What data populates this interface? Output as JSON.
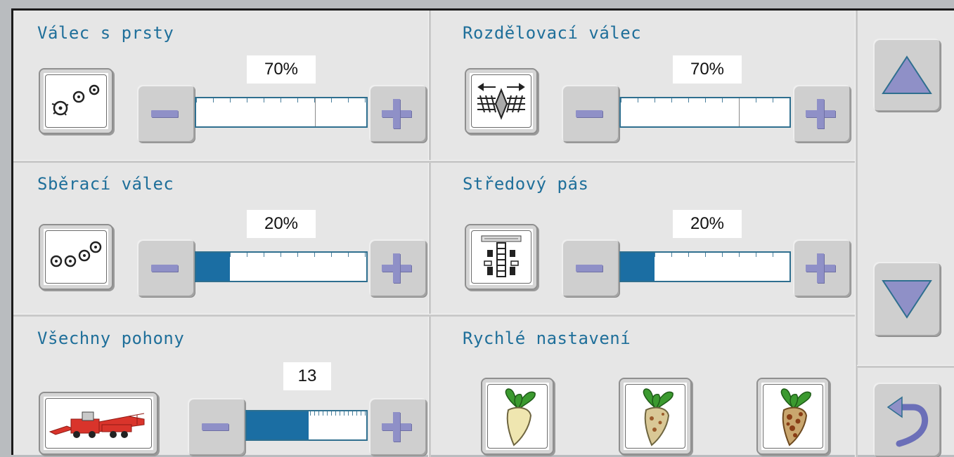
{
  "panels": {
    "valec_s_prsty": {
      "title": "Válec s prsty",
      "value": "70%",
      "level": 0.7
    },
    "rozdelovaci_valec": {
      "title": "Rozdělovací válec",
      "value": "70%",
      "level": 0.7
    },
    "sberaci_valec": {
      "title": "Sběrací válec",
      "value": "20%",
      "level": 0.2
    },
    "stredovy_pas": {
      "title": "Středový pás",
      "value": "20%",
      "level": 0.2
    },
    "vsechny_pohony": {
      "title": "Všechny pohony",
      "value": "13",
      "level": 0.52
    },
    "rychle_nastaveni": {
      "title": "Rychlé nastavení"
    }
  },
  "icons": {
    "finger_roller": "finger-roller-icon",
    "distribution_roller": "distribution-roller-icon",
    "pickup_roller": "pickup-roller-icon",
    "center_belt": "center-belt-icon",
    "harvester": "harvester-icon",
    "beet_preset_1": "beet-clean-icon",
    "beet_preset_2": "beet-medium-icon",
    "beet_preset_3": "beet-dirty-icon",
    "scroll_up": "triangle-up-icon",
    "scroll_down": "triangle-down-icon",
    "back": "return-arrow-icon"
  },
  "colors": {
    "title_text": "#1f6f9a",
    "bar_fill": "#1b6ea3",
    "button_glyph": "#8f90c7"
  }
}
